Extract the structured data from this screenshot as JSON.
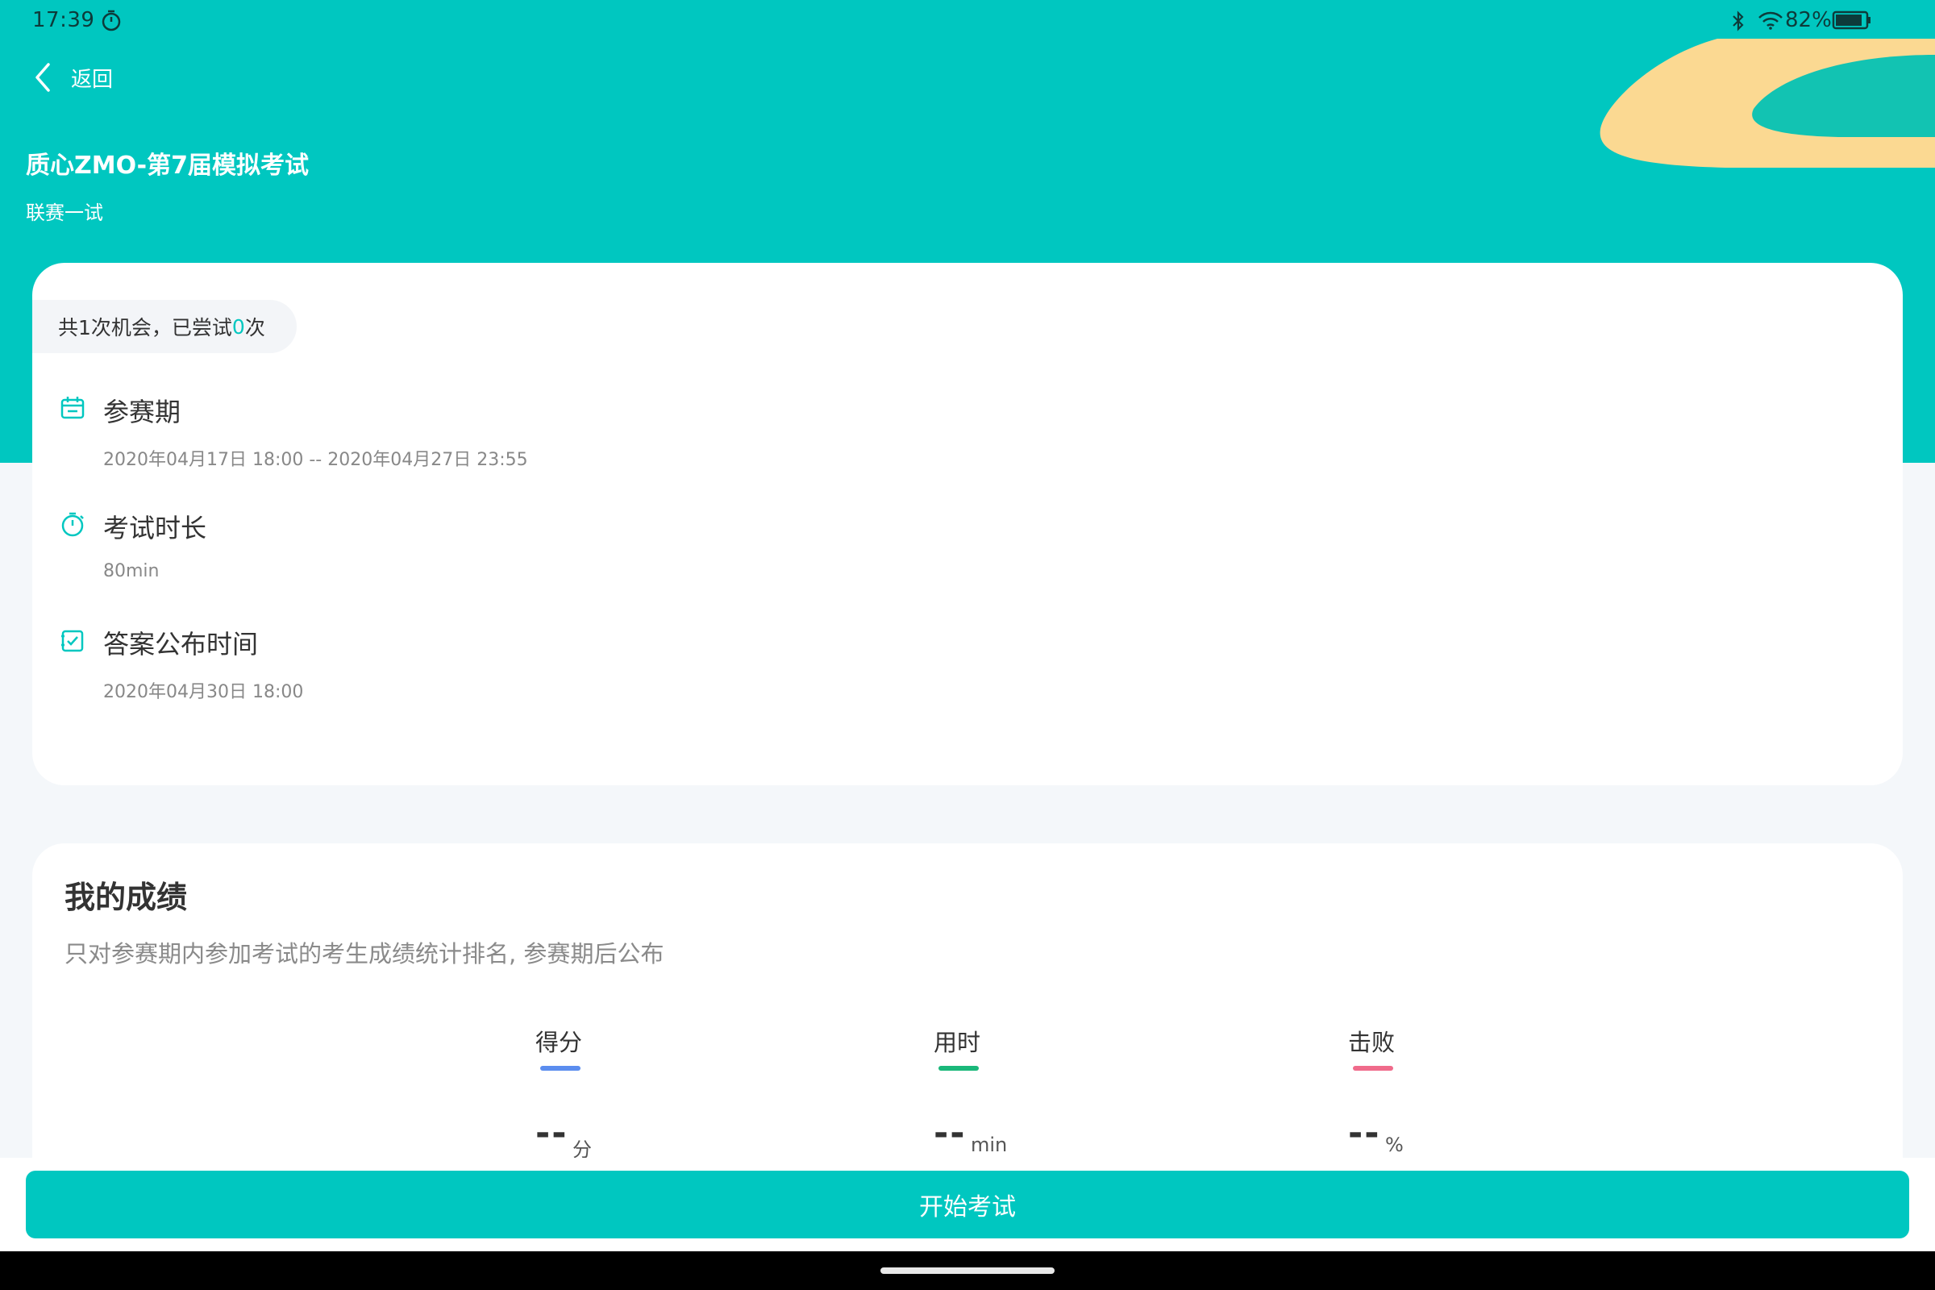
{
  "status_bar": {
    "time": "17:39",
    "battery": "82%",
    "icons": [
      "timer-icon",
      "bluetooth-icon",
      "wifi-icon",
      "battery-icon"
    ]
  },
  "header": {
    "back_label": "返回",
    "exam_title": "质心ZMO-第7届模拟考试",
    "exam_subtitle": "联赛一试"
  },
  "attempts": {
    "prefix": "共1次机会，已尝试",
    "count": "0",
    "suffix": "次"
  },
  "info": {
    "period": {
      "label": "参赛期",
      "value": "2020年04月17日 18:00  --  2020年04月27日 23:55",
      "icon": "calendar-icon"
    },
    "duration": {
      "label": "考试时长",
      "value": "80min",
      "icon": "stopwatch-icon"
    },
    "answer_time": {
      "label": "答案公布时间",
      "value": "2020年04月30日 18:00",
      "icon": "checklist-icon"
    }
  },
  "score": {
    "title": "我的成绩",
    "description": "只对参赛期内参加考试的考生成绩统计排名, 参赛期后公布",
    "metrics": [
      {
        "label": "得分",
        "value": "--",
        "unit": "分",
        "color": "#5b8def"
      },
      {
        "label": "用时",
        "value": "--",
        "unit": "min",
        "color": "#1ab87a"
      },
      {
        "label": "击败",
        "value": "--",
        "unit": "%",
        "color": "#f06b8b"
      }
    ]
  },
  "start_button": "开始考试",
  "colors": {
    "primary": "#00c7c0",
    "background": "#f4f7fa",
    "deco_yellow": "#fbd992"
  }
}
